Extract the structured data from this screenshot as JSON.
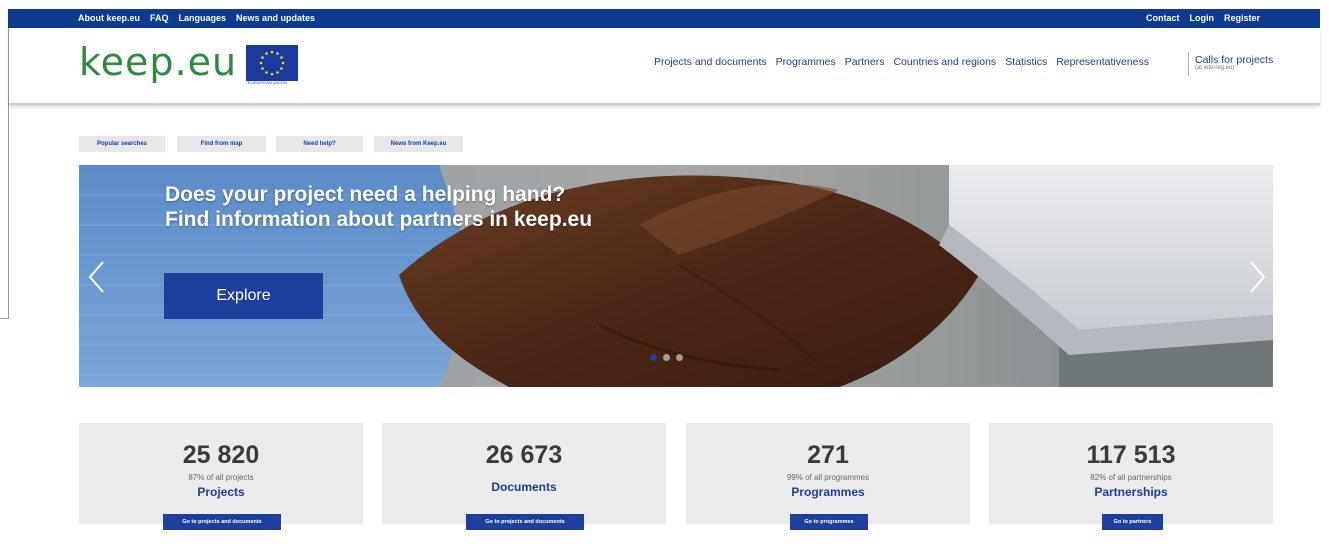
{
  "topbar": {
    "left": [
      "About keep.eu",
      "FAQ",
      "Languages",
      "News and updates"
    ],
    "right": [
      "Contact",
      "Login",
      "Register"
    ]
  },
  "header": {
    "logo": "keep.eu",
    "eu_caption": "EUROPEAN UNION",
    "nav": [
      "Projects and documents",
      "Programmes",
      "Partners",
      "Countries and regions",
      "Statistics",
      "Representativeness"
    ],
    "calls_title": "Calls for projects",
    "calls_sub": "(at interreg.eu)"
  },
  "quick_links": [
    "Popular searches",
    "Find from map",
    "Need help?",
    "News from Keep.eu"
  ],
  "hero": {
    "line1": "Does your project need a helping hand?",
    "line2": "Find information about partners in keep.eu",
    "button": "Explore",
    "dots": 3,
    "active_dot": 1
  },
  "stats": [
    {
      "number": "25 820",
      "pct": "87% of all projects",
      "label": "Projects",
      "button": "Go to projects and documents"
    },
    {
      "number": "26 673",
      "pct": "",
      "label": "Documents",
      "button": "Go to projects and documents"
    },
    {
      "number": "271",
      "pct": "99% of all programmes",
      "label": "Programmes",
      "button": "Go to programmes"
    },
    {
      "number": "117 513",
      "pct": "82% of all partnerships",
      "label": "Partnerships",
      "button": "Go to partners"
    }
  ],
  "colors": {
    "brand_blue": "#1f3f9d",
    "topbar_blue": "#0d3b8f",
    "logo_green": "#2e8b3d",
    "stat_bg": "#ebebed"
  }
}
